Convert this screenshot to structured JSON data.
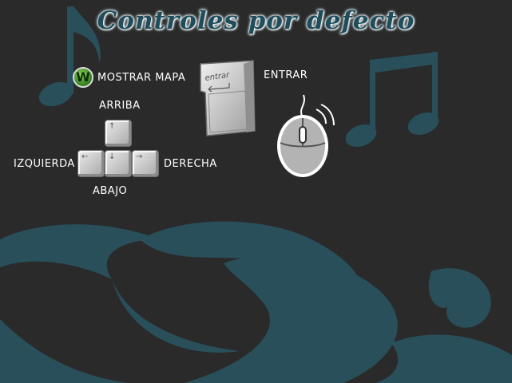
{
  "screen": {
    "title": "Controles por defecto"
  },
  "controls": {
    "map": {
      "badge": "W",
      "label": "MOSTRAR MAPA"
    },
    "enter": {
      "key_text": "entrar",
      "label": "ENTRAR"
    },
    "arrows": {
      "up": "ARRIBA",
      "down": "ABAJO",
      "left": "IZQUIERDA",
      "right": "DERECHA"
    }
  },
  "colors": {
    "background": "#2a2a2a",
    "swirl": "#294f5a",
    "title": "#1f4d5c",
    "badge_green": "#3e9a24"
  },
  "icons": [
    "music-note-icon",
    "swirl-ornament",
    "arrow-keys-icon",
    "enter-key-icon",
    "mouse-icon"
  ]
}
